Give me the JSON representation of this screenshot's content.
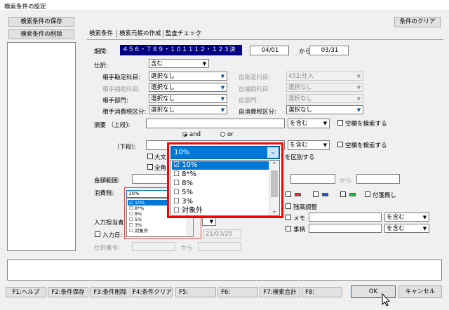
{
  "window": {
    "title": "検索条件の設定"
  },
  "left_buttons": {
    "save": "検索条件の保存",
    "delete": "検索条件の削除"
  },
  "clear_button": "条件のクリア",
  "tabs": [
    "検索条件",
    "検索元帳の作成",
    "監査チェック"
  ],
  "period": {
    "label": "期間:",
    "months": "４５６・７８９・１０１１１２・１２３決",
    "from": "04/01",
    "sep": "から",
    "to": "03/31"
  },
  "shiwake": {
    "label": "仕訳:",
    "value": "含む"
  },
  "accounts": {
    "aite_kamoku": {
      "label": "相手勘定科目:",
      "value": "選択なし"
    },
    "aite_hojo": {
      "label": "相手補助科目:",
      "value": "選択なし"
    },
    "aite_bumon": {
      "label": "相手部門:",
      "value": "選択なし"
    },
    "aite_tax": {
      "label": "相手消費税区分:",
      "value": "選択なし"
    },
    "ji_kamoku": {
      "label": "自勘定科目:",
      "value": "452:仕入"
    },
    "ji_hojo": {
      "label": "自補助科目:",
      "value": "選択なし"
    },
    "ji_bumon": {
      "label": "自部門:",
      "value": "選択なし"
    },
    "ji_tax": {
      "label": "自消費税区分:",
      "value": "選択なし"
    }
  },
  "tekiyo": {
    "upper_label": "摘要 （上段):",
    "lower_label": "（下段):",
    "contains": "を含む",
    "blank_search": "空欄を検索する",
    "and": "and",
    "or": "or",
    "case_label": "大文",
    "width_label": "全角",
    "distinguish": "を区別する"
  },
  "amount": {
    "label": "金額範囲:",
    "sep": "から"
  },
  "tax_rate": {
    "label": "消費税:",
    "selected": "10%",
    "options": [
      "10%",
      "8*%",
      "8%",
      "5%",
      "3%",
      "対象外"
    ],
    "checked": [
      true,
      false,
      false,
      false,
      false,
      false
    ]
  },
  "zoom_dropdown": {
    "selected": "10%",
    "options": [
      "10%",
      "8*%",
      "8%",
      "5%",
      "3%",
      "対象外"
    ],
    "checked": [
      true,
      false,
      false,
      false,
      false,
      false
    ]
  },
  "inputter": {
    "label": "入力担当者"
  },
  "input_date": {
    "label": "入力日:",
    "value": "21/03/25"
  },
  "shiwake_no": {
    "label": "仕訳番号:",
    "sep": "から"
  },
  "right_options": {
    "fusen": "付箋無し",
    "zandaka": "残高調整",
    "memo": "メモ",
    "jiko": "事柄",
    "memo_contains": "を含む",
    "jiko_contains": "を含む"
  },
  "fkeys": [
    "F1:ヘルプ",
    "F2:条件保存",
    "F3:条件削除",
    "F4:条件クリア",
    "F5:",
    "F6:",
    "F7:検索合計",
    "F8:"
  ],
  "ok": "OK",
  "cancel": "キャンセル",
  "colors": {
    "selection": "#0078d7",
    "period_bg": "#000080",
    "highlight_border": "#ff0000"
  }
}
